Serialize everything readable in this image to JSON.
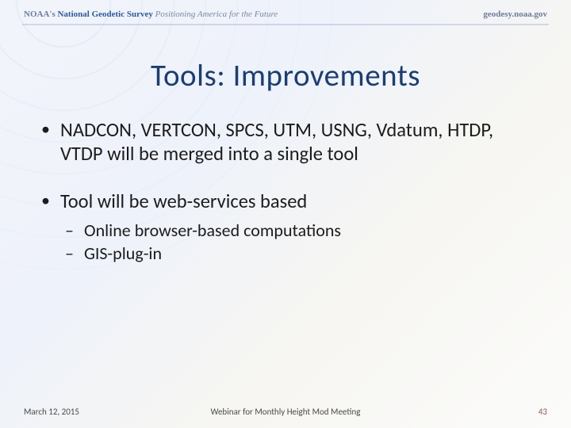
{
  "header": {
    "org": "NOAA's",
    "name": "National Geodetic Survey",
    "tagline": "Positioning America for the Future",
    "site": "geodesy.noaa.gov"
  },
  "title": "Tools:  Improvements",
  "bullets": [
    {
      "text": "NADCON, VERTCON, SPCS, UTM, USNG, Vdatum, HTDP, VTDP will be merged into a single tool",
      "sub": []
    },
    {
      "text": "Tool will be web-services based",
      "sub": [
        "Online browser-based computations",
        "GIS-plug-in"
      ]
    }
  ],
  "footer": {
    "date": "March 12, 2015",
    "caption": "Webinar for Monthly Height Mod Meeting",
    "page": "43"
  }
}
